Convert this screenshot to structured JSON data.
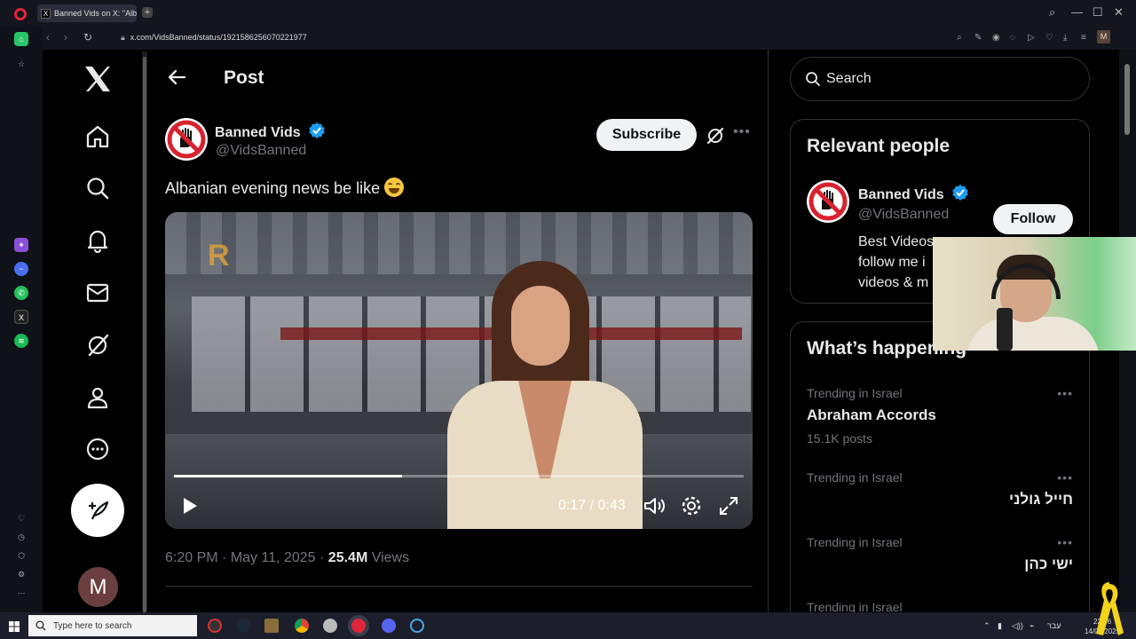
{
  "browser": {
    "tab_title": "Banned Vids on X: \"Alban",
    "tab_favicon": "X",
    "url": "x.com/VidsBanned/status/1921586256070221977",
    "profile_initial": "M"
  },
  "nav": {
    "avatar_initial": "M"
  },
  "post": {
    "header_title": "Post",
    "author_name": "Banned Vids",
    "author_handle": "@VidsBanned",
    "subscribe_label": "Subscribe",
    "text": "Albanian evening news be like",
    "video": {
      "current_time": "0:17",
      "duration": "0:43",
      "time_label": "0:17 / 0:43",
      "progress_fraction": 0.4
    },
    "time": "6:20 PM",
    "date": "May 11, 2025",
    "views_count": "25.4M",
    "views_label": "Views"
  },
  "sidebar": {
    "search_placeholder": "Search",
    "relevant": {
      "title": "Relevant people",
      "name": "Banned Vids",
      "handle": "@VidsBanned",
      "follow_label": "Follow",
      "bio_line1": "Best Videos",
      "bio_line2": "follow me i",
      "bio_line3": "videos & m"
    },
    "happening": {
      "title": "What’s happening",
      "trends": [
        {
          "context": "Trending in Israel",
          "name": "Abraham Accords",
          "count": "15.1K posts"
        },
        {
          "context": "Trending in Israel",
          "name": "חייל גולני",
          "count": ""
        },
        {
          "context": "Trending in Israel",
          "name": "ישי כהן",
          "count": ""
        },
        {
          "context": "Trending in Israel",
          "name": "",
          "count": ""
        }
      ]
    }
  },
  "taskbar": {
    "search_placeholder": "Type here to search",
    "lang": "עבר",
    "time": "22:06",
    "date": "14/05/2025"
  },
  "colors": {
    "x_bg": "#000000",
    "x_text": "#e7e9ea",
    "x_secondary": "#71767b",
    "verified_blue": "#1d9bf0",
    "button_light": "#eff3f4",
    "opera_red": "#e0263a"
  }
}
